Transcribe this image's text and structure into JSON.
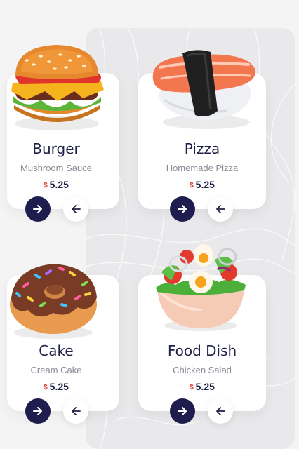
{
  "cards": [
    {
      "title": "Burger",
      "subtitle": "Mushroom Sauce",
      "currency": "$",
      "price": "5.25",
      "food_icon": "burger-icon"
    },
    {
      "title": "Pizza",
      "subtitle": "Homemade Pizza",
      "currency": "$",
      "price": "5.25",
      "food_icon": "sushi-icon"
    },
    {
      "title": "Cake",
      "subtitle": "Cream Cake",
      "currency": "$",
      "price": "5.25",
      "food_icon": "donut-icon"
    },
    {
      "title": "Food Dish",
      "subtitle": "Chicken Salad",
      "currency": "$",
      "price": "5.25",
      "food_icon": "salad-bowl-icon"
    }
  ],
  "buttons": {
    "primary_icon": "arrow-right-icon",
    "secondary_icon": "arrow-left-icon"
  },
  "colors": {
    "accent": "#1f1d4d",
    "price_currency": "#e0352b",
    "title": "#1f2147",
    "subtitle": "#8a8b97"
  }
}
